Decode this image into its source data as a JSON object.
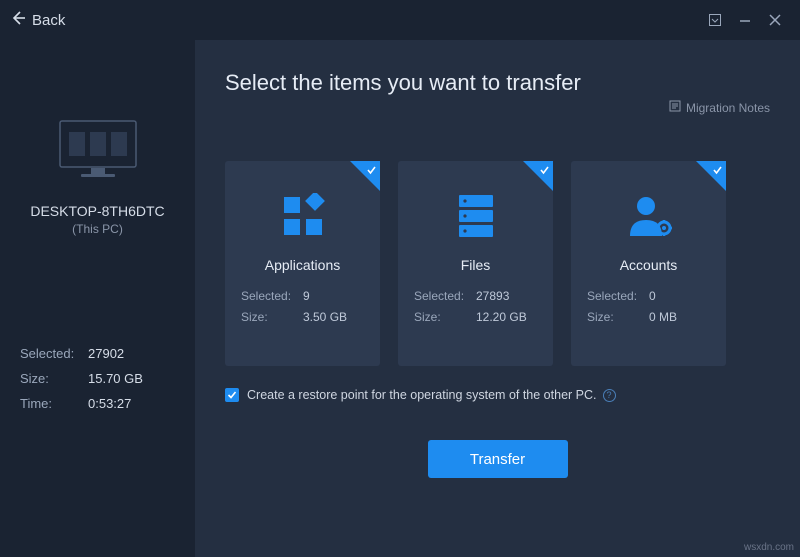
{
  "titlebar": {
    "back_label": "Back"
  },
  "sidebar": {
    "pc_name": "DESKTOP-8TH6DTC",
    "pc_sub": "(This PC)",
    "selected_label": "Selected:",
    "selected_value": "27902",
    "size_label": "Size:",
    "size_value": "15.70 GB",
    "time_label": "Time:",
    "time_value": "0:53:27"
  },
  "main": {
    "title": "Select the items you want to transfer",
    "notes_label": "Migration Notes",
    "cards": [
      {
        "title": "Applications",
        "selected_label": "Selected:",
        "selected_value": "9",
        "size_label": "Size:",
        "size_value": "3.50 GB",
        "icon": "apps"
      },
      {
        "title": "Files",
        "selected_label": "Selected:",
        "selected_value": "27893",
        "size_label": "Size:",
        "size_value": "12.20 GB",
        "icon": "files"
      },
      {
        "title": "Accounts",
        "selected_label": "Selected:",
        "selected_value": "0",
        "size_label": "Size:",
        "size_value": "0 MB",
        "icon": "accounts"
      }
    ],
    "restore_label": "Create a restore point for the operating system of the other PC.",
    "transfer_label": "Transfer"
  },
  "watermark": "wsxdn.com"
}
